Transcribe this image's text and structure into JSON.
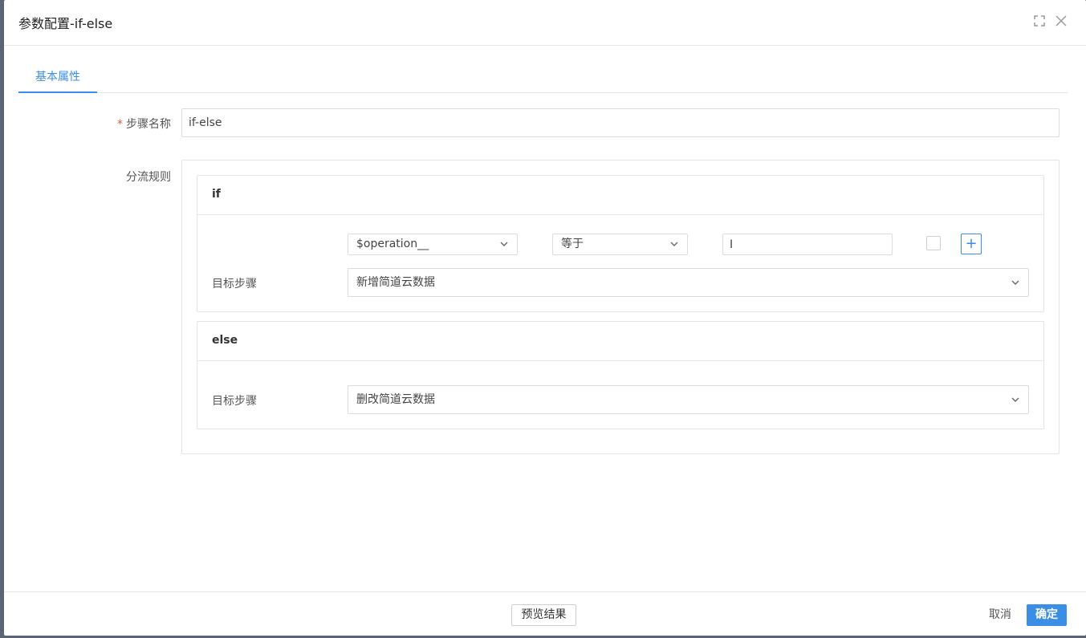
{
  "dialog": {
    "title": "参数配置-if-else"
  },
  "tabs": [
    {
      "label": "基本属性",
      "active": true
    }
  ],
  "form": {
    "step_name_label": "步骤名称",
    "required_mark": "*",
    "step_name_value": "if-else",
    "split_rules_label": "分流规则"
  },
  "if_branch": {
    "header": "if",
    "condition": {
      "field_value": "$operation__",
      "operator_value": "等于",
      "compare_value": "I",
      "checkbox_checked": false,
      "add_label": "+"
    },
    "target_label": "目标步骤",
    "target_value": "新增简道云数据"
  },
  "else_branch": {
    "header": "else",
    "target_label": "目标步骤",
    "target_value": "删改简道云数据"
  },
  "footer": {
    "preview_label": "预览结果",
    "cancel_label": "取消",
    "ok_label": "确定"
  },
  "colors": {
    "accent": "#3a8ee6",
    "required": "#e25c3c"
  }
}
